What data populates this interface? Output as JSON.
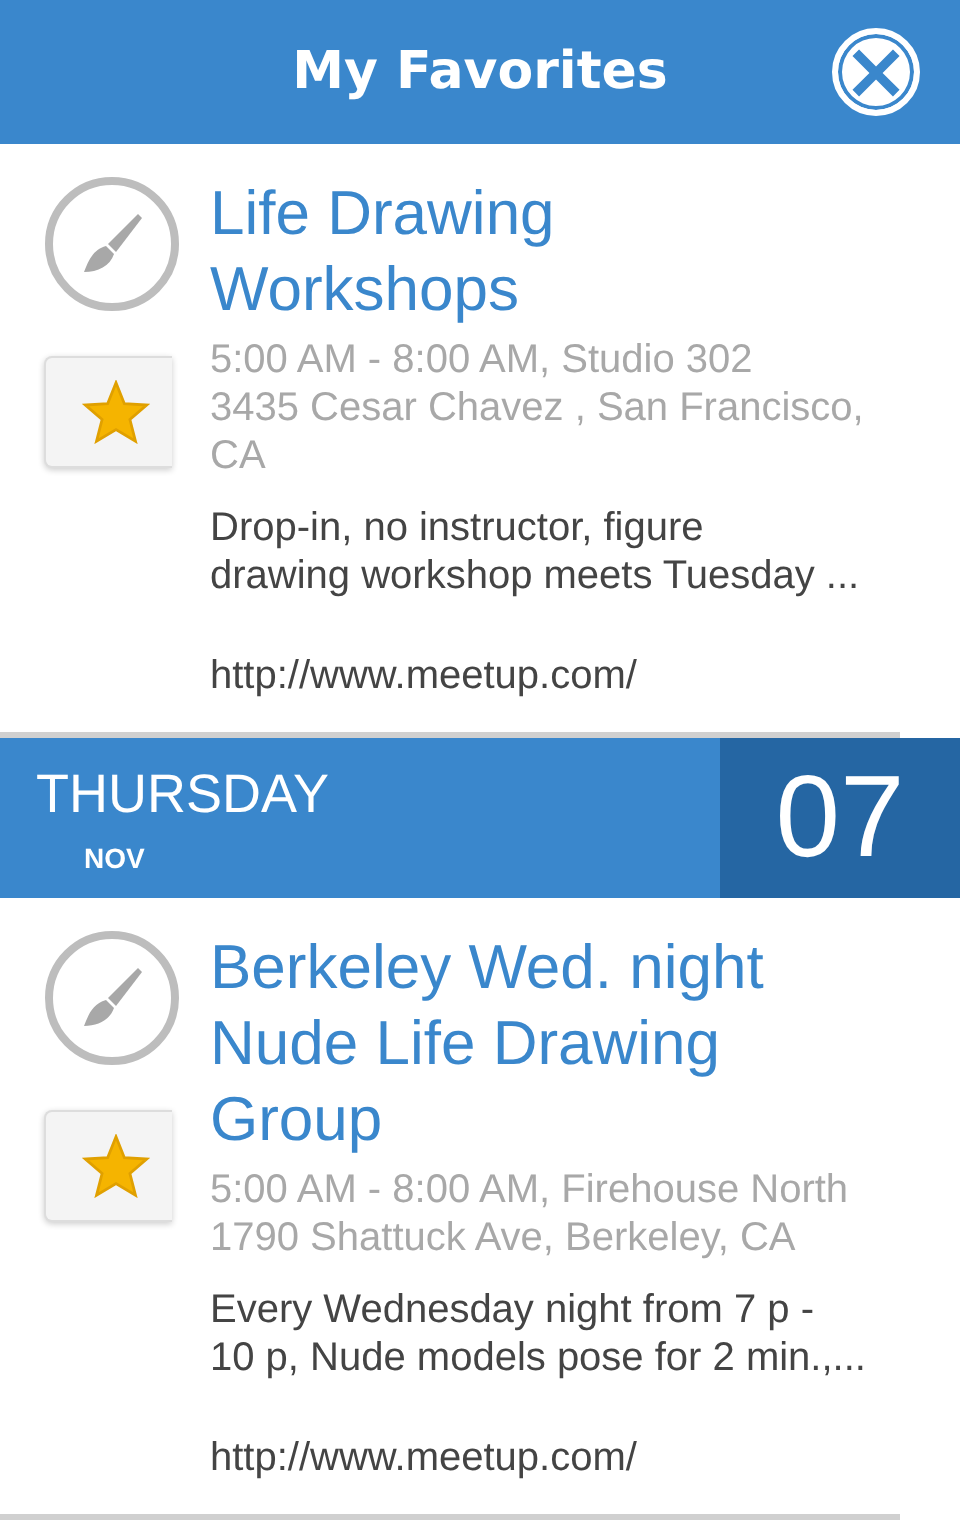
{
  "header": {
    "title": "My Favorites",
    "close_icon": "×"
  },
  "sections": [
    {
      "events": [
        {
          "title": "Life Drawing\nWorkshops",
          "favorite": true,
          "details": "5:00 AM - 8:00 AM, Studio 302\n3435 Cesar Chavez , San Francisco,\nCA",
          "description": "Drop-in, no instructor, figure\ndrawing workshop meets Tuesday ...",
          "link": "http://www.meetup.com/"
        }
      ]
    },
    {
      "date": {
        "weekday": "THURSDAY",
        "month": "NOV",
        "day": "07"
      },
      "events": [
        {
          "title": "Berkeley Wed. night\nNude Life Drawing\nGroup",
          "favorite": true,
          "details": "5:00 AM - 8:00 AM, Firehouse North\n1790 Shattuck Ave, Berkeley, CA",
          "description": "Every Wednesday night from 7 p -\n10 p, Nude models pose for 2 min.,...",
          "link": "http://www.meetup.com/"
        }
      ]
    }
  ]
}
